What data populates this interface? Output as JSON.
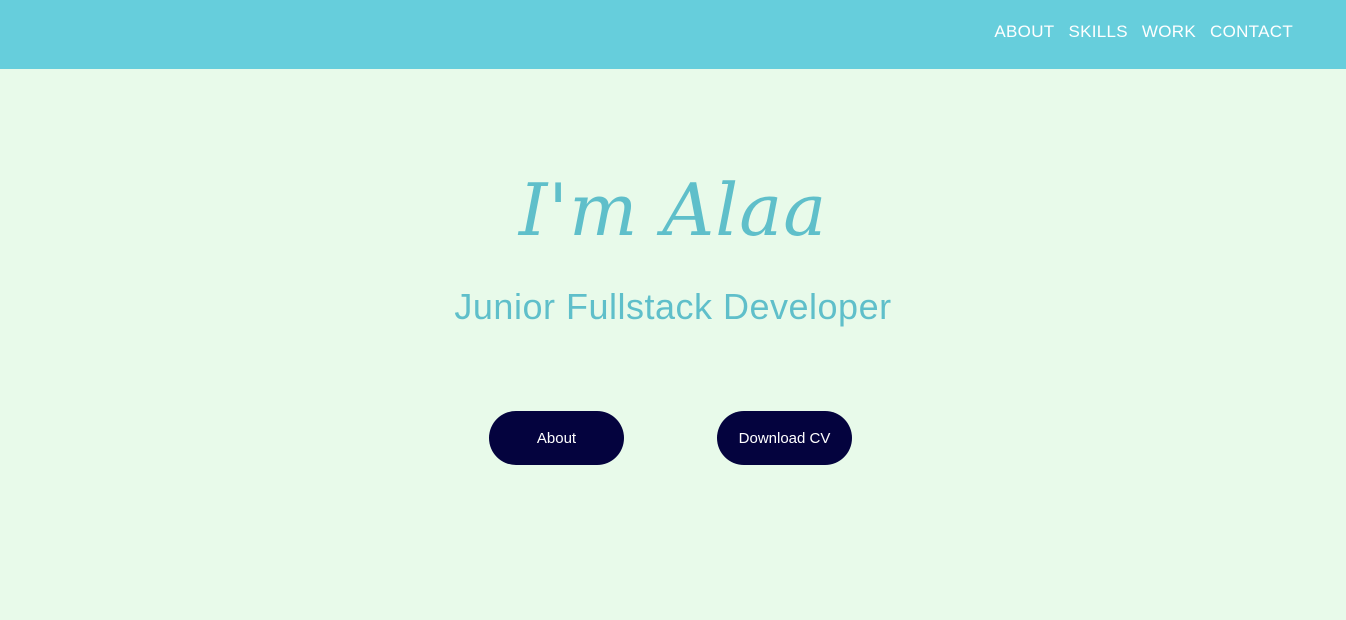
{
  "nav": {
    "items": [
      {
        "label": "ABOUT"
      },
      {
        "label": "SKILLS"
      },
      {
        "label": "WORK"
      },
      {
        "label": "CONTACT"
      }
    ]
  },
  "hero": {
    "title": "I'm Alaa",
    "subtitle": "Junior Fullstack Developer",
    "buttons": {
      "about_label": "About",
      "cv_label": "Download CV"
    }
  },
  "colors": {
    "nav_background": "#66cedc",
    "page_background": "#e8faea",
    "accent_text": "#5fbfca",
    "button_background": "#04033e"
  }
}
